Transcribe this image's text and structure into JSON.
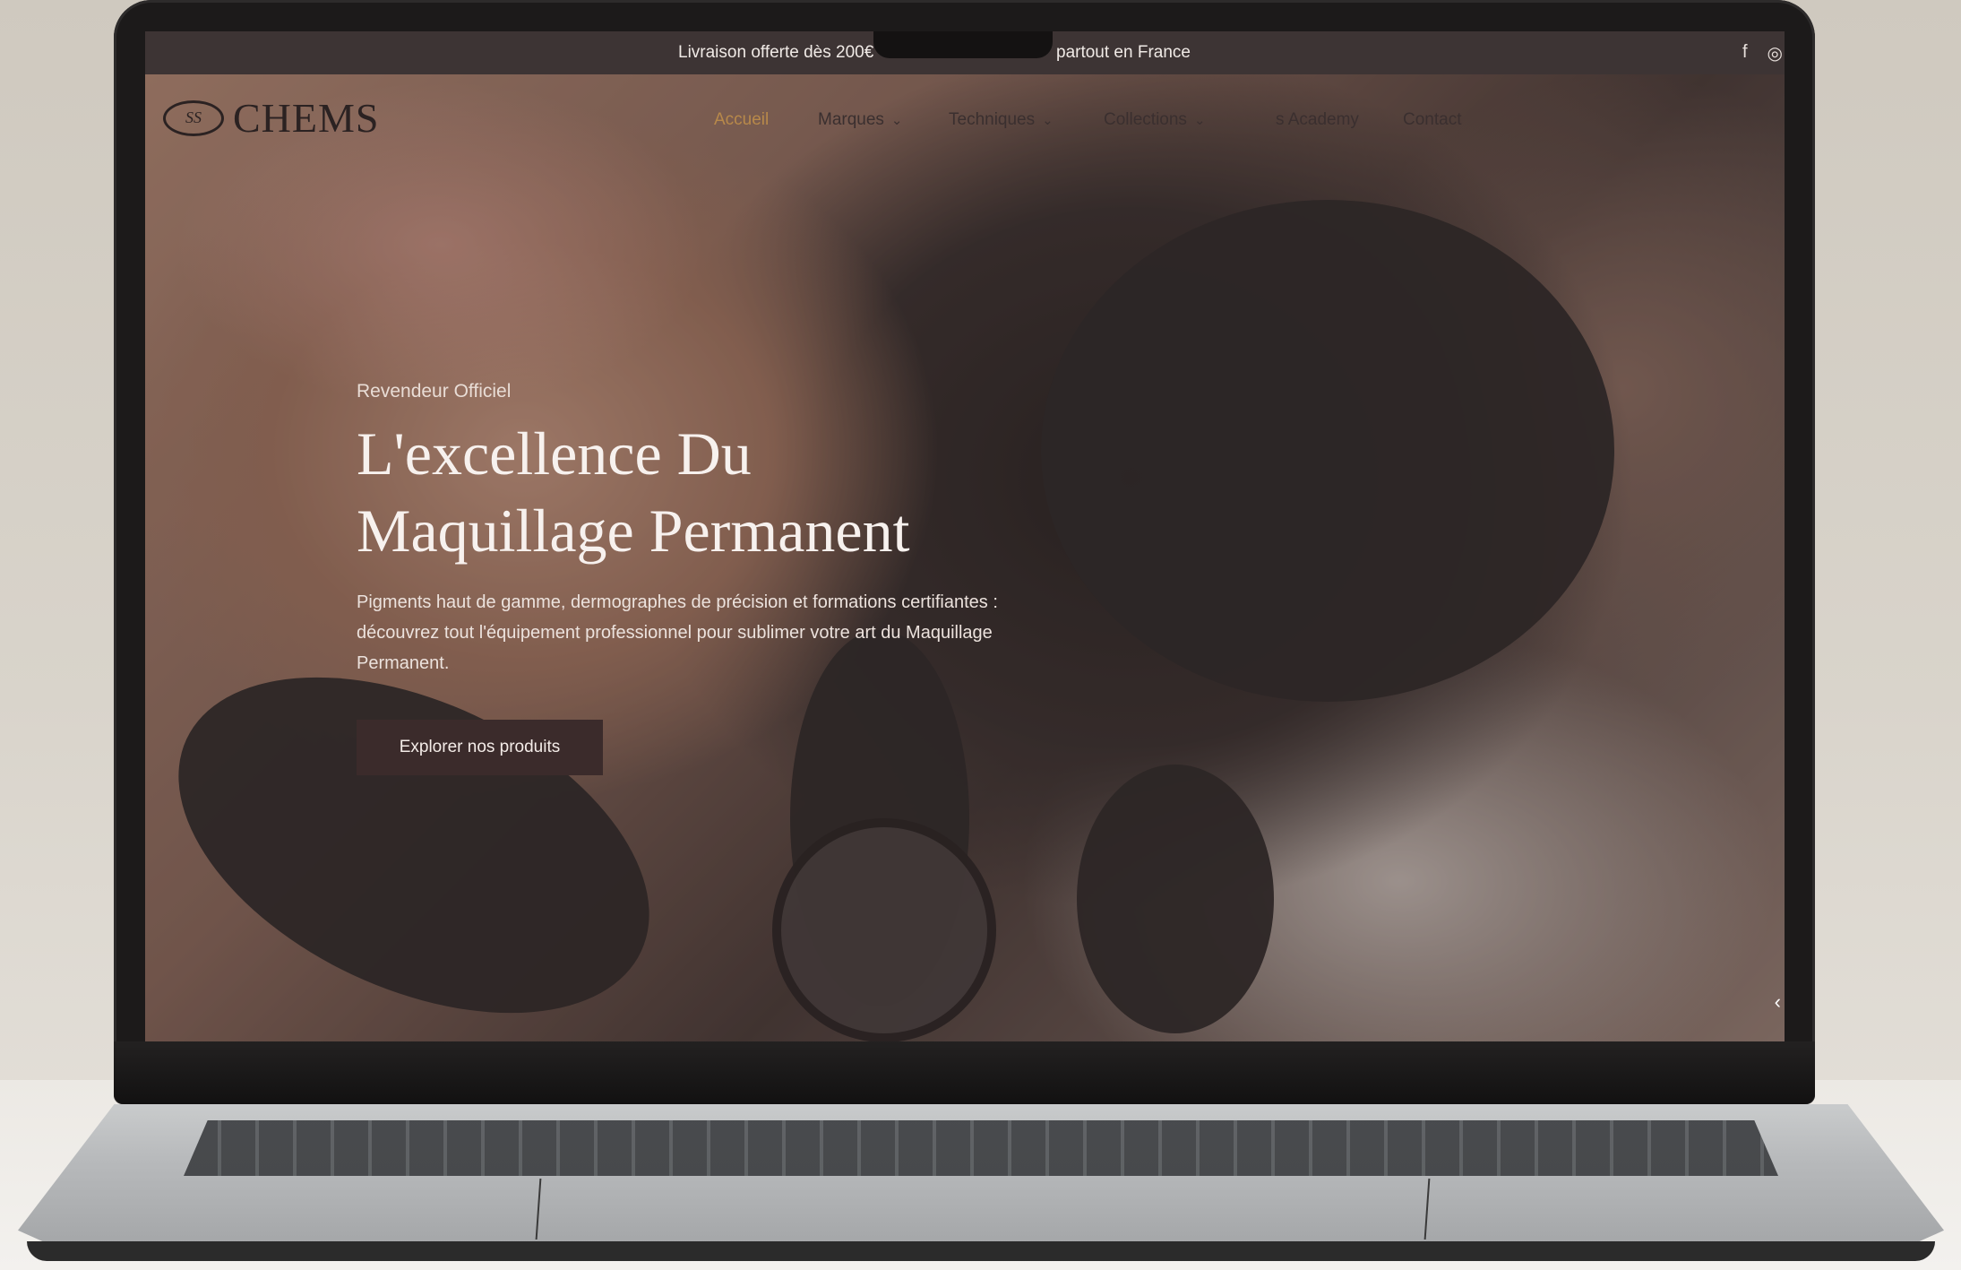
{
  "promo": {
    "text_left": "Livraison offerte dès 200€",
    "text_right": "partout en France",
    "social_icons": [
      "facebook-icon",
      "instagram-icon"
    ]
  },
  "header": {
    "logo_mark": "SS",
    "logo_text": "CHEMS",
    "nav": [
      {
        "label": "Accueil",
        "active": true,
        "dropdown": false
      },
      {
        "label": "Marques",
        "active": false,
        "dropdown": true
      },
      {
        "label": "Techniques",
        "active": false,
        "dropdown": true
      },
      {
        "label": "Collections",
        "active": false,
        "dropdown": true
      },
      {
        "label": "s Academy",
        "active": false,
        "dropdown": false
      },
      {
        "label": "Contact",
        "active": false,
        "dropdown": false
      }
    ]
  },
  "hero": {
    "eyebrow": "Revendeur Officiel",
    "title_line1": "L'excellence Du",
    "title_line2": "Maquillage Permanent",
    "description": "Pigments haut de gamme, dermographes de précision et formations certifiantes : découvrez tout l'équipement professionnel pour sublimer votre art du Maquillage Permanent.",
    "cta_label": "Explorer nos produits"
  },
  "colors": {
    "accent": "#b8894a",
    "promo_bar": "#3d3434",
    "button": "#3b2b2b"
  }
}
